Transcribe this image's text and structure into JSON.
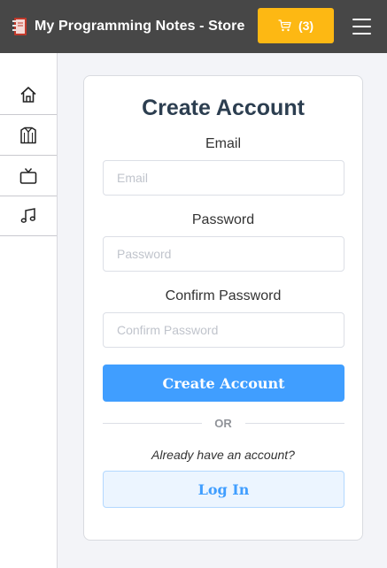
{
  "header": {
    "brand_icon": "notebook-icon",
    "title": "My Programming Notes - Store",
    "cart_label": "(3)",
    "cart_icon": "cart-icon",
    "menu_icon": "hamburger-icon",
    "colors": {
      "bar": "#474747",
      "cart": "#fdb813"
    }
  },
  "sidebar": {
    "items": [
      {
        "icon": "home-icon"
      },
      {
        "icon": "shirt-icon"
      },
      {
        "icon": "tv-icon"
      },
      {
        "icon": "music-note-icon"
      }
    ]
  },
  "form": {
    "title": "Create Account",
    "email_label": "Email",
    "email_placeholder": "Email",
    "email_value": "",
    "password_label": "Password",
    "password_placeholder": "Password",
    "password_value": "",
    "confirm_label": "Confirm Password",
    "confirm_placeholder": "Confirm Password",
    "confirm_value": "",
    "submit_label": "Create Account",
    "divider_text": "OR",
    "already_text": "Already have an account?",
    "login_label": "Log In",
    "colors": {
      "primary": "#409eff",
      "title": "#2c3e50"
    }
  }
}
